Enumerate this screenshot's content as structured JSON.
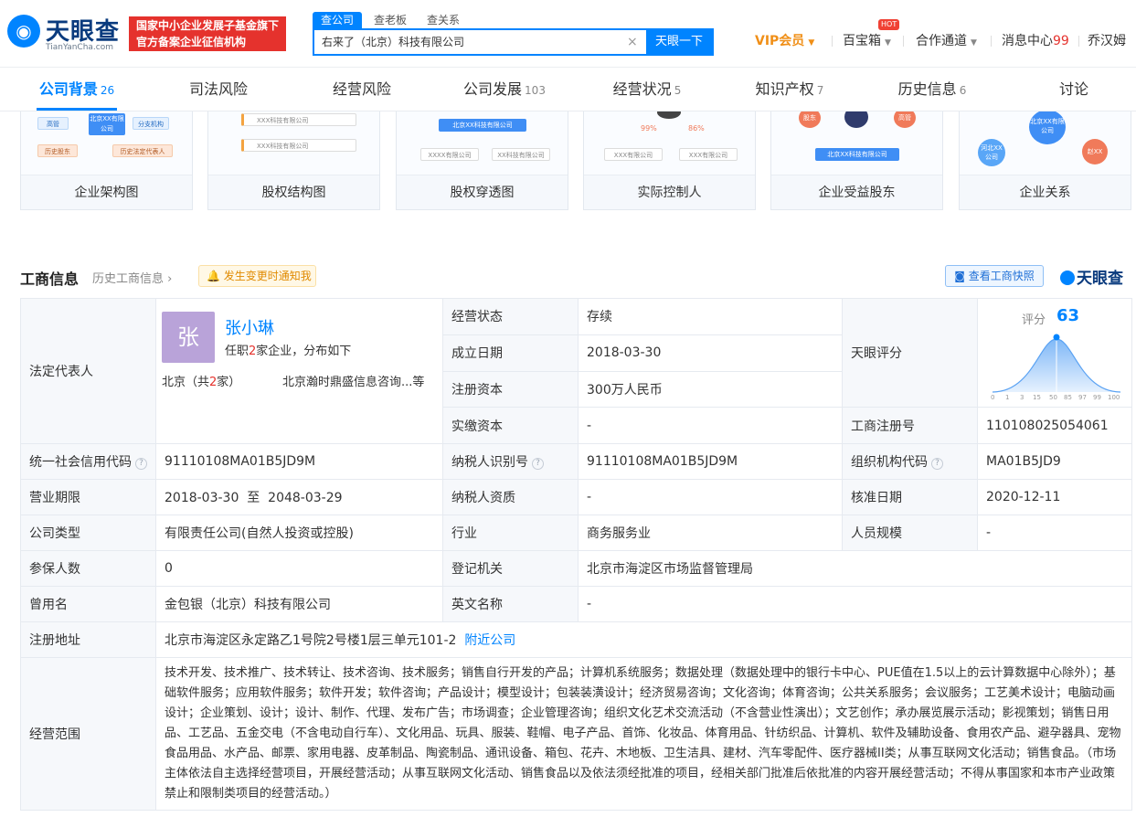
{
  "header": {
    "logo_text": "天眼查",
    "logo_sub": "TianYanCha.com",
    "promo_line1": "国家中小企业发展子基金旗下",
    "promo_line2": "官方备案企业征信机构",
    "search_tabs": [
      "查公司",
      "查老板",
      "查关系"
    ],
    "search_value": "右来了（北京）科技有限公司",
    "search_button": "天眼一下",
    "vip": "VIP会员",
    "baibaoxiang": "百宝箱",
    "hot_badge": "HOT",
    "cooperation": "合作通道",
    "messages": "消息中心",
    "messages_count": "99",
    "user": "乔汉姆"
  },
  "tabs": [
    {
      "label": "公司背景",
      "count": "26"
    },
    {
      "label": "司法风险",
      "count": ""
    },
    {
      "label": "经营风险",
      "count": ""
    },
    {
      "label": "公司发展",
      "count": "103"
    },
    {
      "label": "经营状况",
      "count": "5"
    },
    {
      "label": "知识产权",
      "count": "7"
    },
    {
      "label": "历史信息",
      "count": "6"
    },
    {
      "label": "讨论",
      "count": ""
    }
  ],
  "cards": [
    {
      "label": "企业架构图",
      "mini": [
        "高管",
        "北京XX有限公司",
        "分支机构",
        "历史股东",
        "历史法定代表人"
      ]
    },
    {
      "label": "股权结构图",
      "mini": [
        "XXX科技有限公司",
        "XXX科技有限公司"
      ]
    },
    {
      "label": "股权穿透图",
      "mini": [
        "北京XX科技有限公司",
        "XXXX有限公司",
        "XX科技有限公司"
      ]
    },
    {
      "label": "实际控制人",
      "mini": [
        "99%",
        "86%",
        "XXX有限公司",
        "XXX有限公司"
      ]
    },
    {
      "label": "企业受益股东",
      "mini": [
        "股东",
        "高管",
        "北京XX科技有限公司"
      ]
    },
    {
      "label": "企业关系",
      "mini": [
        "北京XX有限公司",
        "河北XX公司",
        "赵XX"
      ]
    }
  ],
  "section": {
    "title": "工商信息",
    "history": "历史工商信息",
    "notify": "发生变更时通知我",
    "snapshot": "查看工商快照",
    "watermark": "天眼查"
  },
  "legal": {
    "key": "法定代表人",
    "avatar_char": "张",
    "name": "张小琳",
    "sub_pre": "任职",
    "sub_num": "2",
    "sub_post": "家企业，分布如下",
    "city_pre": "北京（共",
    "city_num": "2",
    "city_post": "家）",
    "company": "北京瀚时鼎盛信息咨询...等"
  },
  "score": {
    "key": "天眼评分",
    "label": "评分",
    "value": "63",
    "ticks": [
      "0",
      "1",
      "3",
      "15",
      "50",
      "85",
      "97",
      "99",
      "100"
    ]
  },
  "info": {
    "status_k": "经营状态",
    "status_v": "存续",
    "found_k": "成立日期",
    "found_v": "2018-03-30",
    "capital_k": "注册资本",
    "capital_v": "300万人民币",
    "paid_k": "实缴资本",
    "paid_v": "-",
    "regno_k": "工商注册号",
    "regno_v": "110108025054061",
    "credit_k": "统一社会信用代码",
    "credit_v": "91110108MA01B5JD9M",
    "taxid_k": "纳税人识别号",
    "taxid_v": "91110108MA01B5JD9M",
    "orgcode_k": "组织机构代码",
    "orgcode_v": "MA01B5JD9",
    "term_k": "营业期限",
    "term_v": "2018-03-30  至  2048-03-29",
    "taxqual_k": "纳税人资质",
    "taxqual_v": "-",
    "approve_k": "核准日期",
    "approve_v": "2020-12-11",
    "type_k": "公司类型",
    "type_v": "有限责任公司(自然人投资或控股)",
    "industry_k": "行业",
    "industry_v": "商务服务业",
    "staff_k": "人员规模",
    "staff_v": "-",
    "insured_k": "参保人数",
    "insured_v": "0",
    "authority_k": "登记机关",
    "authority_v": "北京市海淀区市场监督管理局",
    "former_k": "曾用名",
    "former_v": "金包银（北京）科技有限公司",
    "english_k": "英文名称",
    "english_v": "-",
    "addr_k": "注册地址",
    "addr_v": "北京市海淀区永定路乙1号院2号楼1层三单元101-2",
    "addr_link": "附近公司",
    "scope_k": "经营范围",
    "scope_v": "技术开发、技术推广、技术转让、技术咨询、技术服务；销售自行开发的产品；计算机系统服务；数据处理（数据处理中的银行卡中心、PUE值在1.5以上的云计算数据中心除外）；基础软件服务；应用软件服务；软件开发；软件咨询；产品设计；模型设计；包装装潢设计；经济贸易咨询；文化咨询；体育咨询；公共关系服务；会议服务；工艺美术设计；电脑动画设计；企业策划、设计；设计、制作、代理、发布广告；市场调查；企业管理咨询；组织文化艺术交流活动（不含营业性演出）；文艺创作；承办展览展示活动；影视策划；销售日用品、工艺品、五金交电（不含电动自行车）、文化用品、玩具、服装、鞋帽、电子产品、首饰、化妆品、体育用品、针纺织品、计算机、软件及辅助设备、食用农产品、避孕器具、宠物食品用品、水产品、邮票、家用电器、皮革制品、陶瓷制品、通讯设备、箱包、花卉、木地板、卫生洁具、建材、汽车零配件、医疗器械II类；从事互联网文化活动；销售食品。（市场主体依法自主选择经营项目，开展经营活动；从事互联网文化活动、销售食品以及依法须经批准的项目，经相关部门批准后依批准的内容开展经营活动；不得从事国家和本市产业政策禁止和限制类项目的经营活动。）"
  }
}
